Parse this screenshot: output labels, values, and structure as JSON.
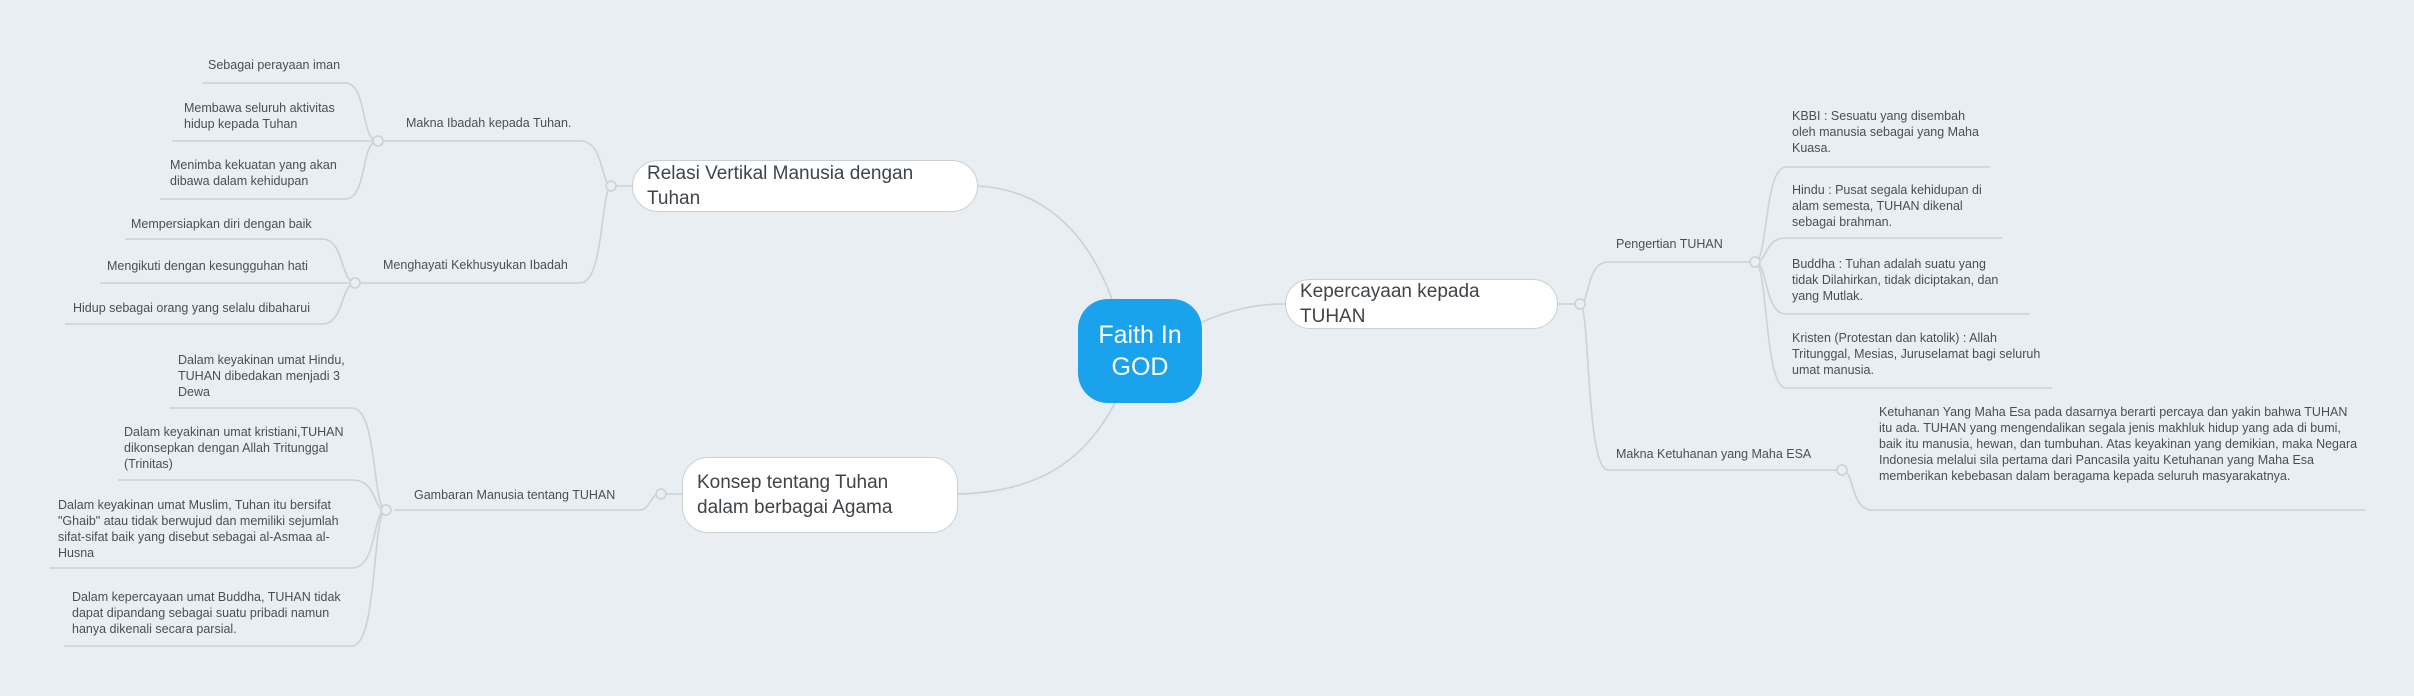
{
  "root": {
    "label": "Faith In GOD"
  },
  "branches": {
    "relasi": {
      "label": "Relasi Vertikal Manusia dengan Tuhan",
      "makna": {
        "label": "Makna Ibadah kepada Tuhan.",
        "items": [
          "Sebagai perayaan iman",
          "Membawa seluruh aktivitas hidup kepada Tuhan",
          "Menimba kekuatan yang akan dibawa dalam kehidupan"
        ]
      },
      "menghayati": {
        "label": "Menghayati Kekhusyukan Ibadah",
        "items": [
          "Mempersiapkan diri dengan baik",
          "Mengikuti dengan kesungguhan hati",
          "Hidup sebagai orang yang selalu dibaharui"
        ]
      }
    },
    "konsep": {
      "label": "Konsep tentang Tuhan dalam berbagai Agama",
      "gambaran": {
        "label": "Gambaran Manusia tentang TUHAN",
        "items": [
          "Dalam keyakinan umat Hindu, TUHAN dibedakan menjadi 3 Dewa",
          "Dalam keyakinan umat kristiani,TUHAN dikonsepkan dengan Allah Tritunggal (Trinitas)",
          "Dalam keyakinan umat Muslim, Tuhan itu bersifat \"Ghaib\" atau tidak berwujud dan memiliki sejumlah sifat-sifat baik yang disebut sebagai al-Asmaa al-Husna",
          "Dalam kepercayaan umat Buddha, TUHAN tidak dapat dipandang sebagai suatu pribadi namun hanya dikenali secara parsial."
        ]
      }
    },
    "kepercayaan": {
      "label": "Kepercayaan kepada TUHAN",
      "pengertian": {
        "label": "Pengertian TUHAN",
        "items": [
          "KBBI : Sesuatu yang disembah oleh manusia sebagai yang Maha Kuasa.",
          "Hindu : Pusat segala kehidupan di alam semesta, TUHAN dikenal sebagai brahman.",
          "Buddha : Tuhan adalah suatu yang tidak Dilahirkan, tidak diciptakan, dan yang Mutlak.",
          "Kristen (Protestan dan katolik) : Allah Tritunggal, Mesias, Juruselamat bagi seluruh umat manusia."
        ]
      },
      "ketuhanan": {
        "label": "Makna Ketuhanan yang Maha ESA",
        "items": [
          "Ketuhanan Yang Maha Esa pada dasarnya berarti percaya dan yakin bahwa TUHAN itu ada. TUHAN yang mengendalikan segala jenis makhluk hidup yang ada di bumi, baik itu manusia, hewan, dan tumbuhan. Atas keyakinan yang demikian, maka Negara Indonesia melalui sila pertama dari Pancasila yaitu Ketuhanan yang Maha Esa memberikan kebebasan dalam beragama kepada seluruh masyarakatnya."
        ]
      }
    }
  }
}
